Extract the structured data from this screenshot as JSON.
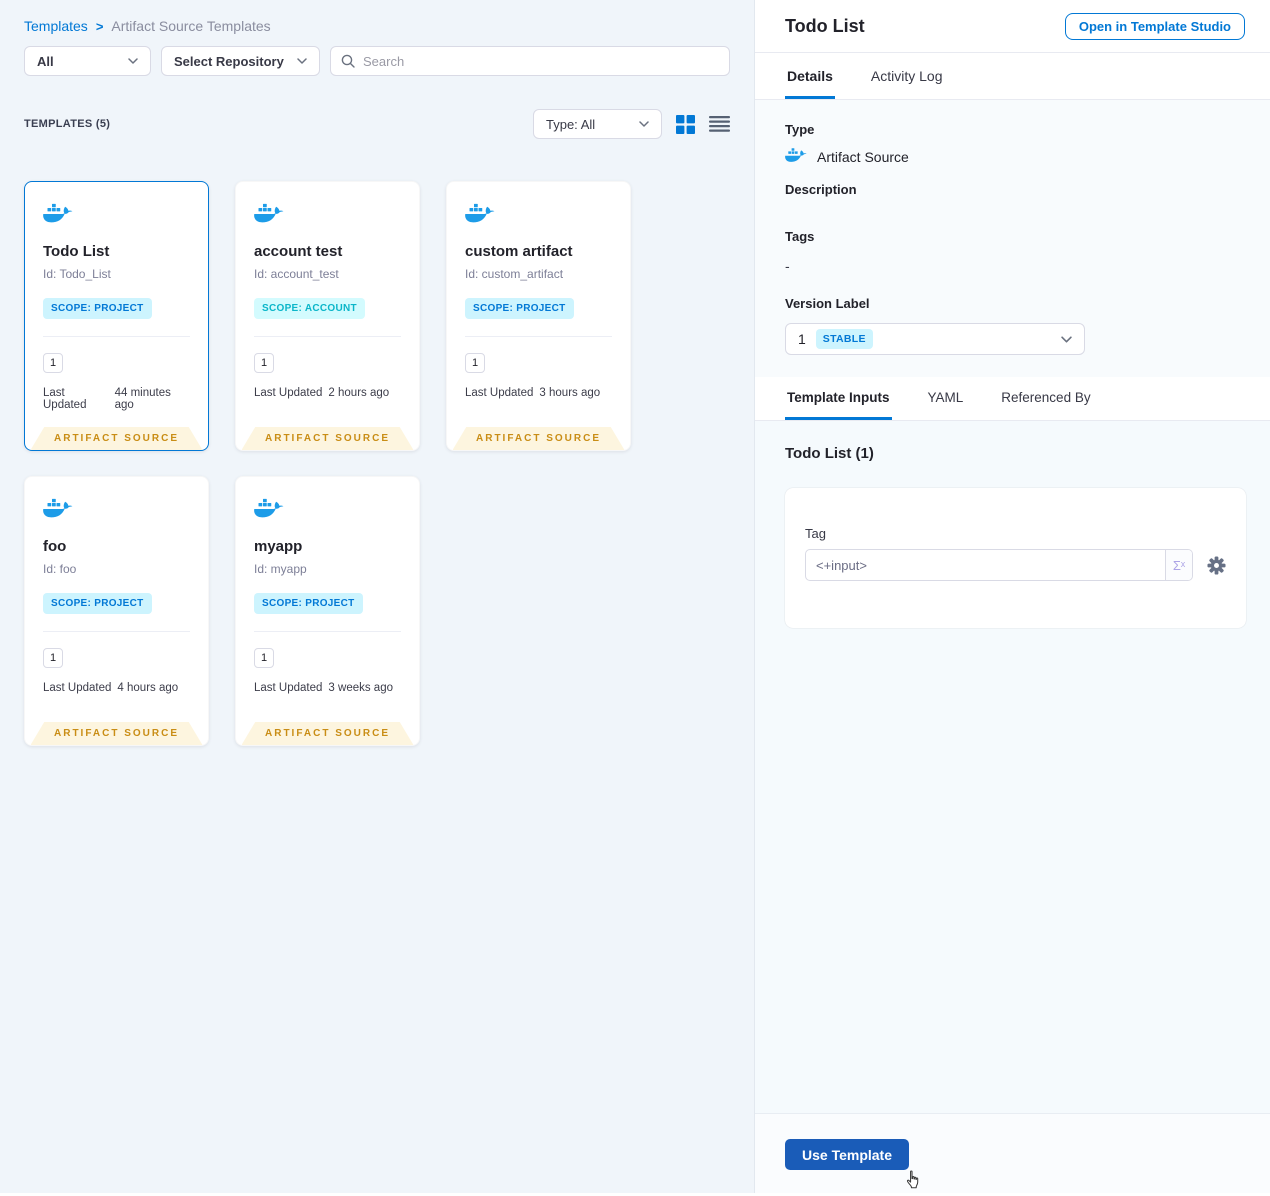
{
  "colors": {
    "accent": "#0278d5",
    "docker-blue": "#1d9ce8",
    "banner-text": "#c98d15",
    "banner-bg": "#fdf5df",
    "scope-project-bg": "#cdf4fe",
    "scope-project-text": "#0278d5",
    "scope-account-bg": "#d3fbfe",
    "scope-account-text": "#0bb6c9",
    "stable-bg": "#cdf4fe",
    "stable-text": "#0278d5",
    "primary-button-bg": "#1a5cb8"
  },
  "breadcrumb": {
    "root": "Templates",
    "separator": ">",
    "current": "Artifact Source Templates"
  },
  "filters": {
    "scope": "All",
    "repository": "Select Repository",
    "search_placeholder": "Search"
  },
  "list_header": {
    "count": "TEMPLATES (5)",
    "type_filter": "Type: All"
  },
  "card_labels": {
    "last_updated": "Last Updated",
    "banner": "ARTIFACT SOURCE"
  },
  "cards": [
    {
      "title": "Todo List",
      "id": "Id: Todo_List",
      "scope": "SCOPE: PROJECT",
      "scope_type": "project",
      "versions": "1",
      "updated": "44 minutes ago"
    },
    {
      "title": "account test",
      "id": "Id: account_test",
      "scope": "SCOPE: ACCOUNT",
      "scope_type": "account",
      "versions": "1",
      "updated": "2 hours ago"
    },
    {
      "title": "custom artifact",
      "id": "Id: custom_artifact",
      "scope": "SCOPE: PROJECT",
      "scope_type": "project",
      "versions": "1",
      "updated": "3 hours ago"
    },
    {
      "title": "foo",
      "id": "Id: foo",
      "scope": "SCOPE: PROJECT",
      "scope_type": "project",
      "versions": "1",
      "updated": "4 hours ago"
    },
    {
      "title": "myapp",
      "id": "Id: myapp",
      "scope": "SCOPE: PROJECT",
      "scope_type": "project",
      "versions": "1",
      "updated": "3 weeks ago"
    }
  ],
  "panel": {
    "title": "Todo List",
    "studio_button": "Open in Template Studio",
    "tabs": {
      "details": "Details",
      "activity": "Activity Log"
    },
    "fields": {
      "type_label": "Type",
      "type_value": "Artifact Source",
      "description_label": "Description",
      "tags_label": "Tags",
      "tags_value": "-",
      "version_label": "Version Label",
      "version_number": "1",
      "version_badge": "STABLE"
    },
    "inputs_tabs": {
      "inputs": "Template Inputs",
      "yaml": "YAML",
      "referenced": "Referenced By"
    },
    "inputs_heading": "Todo List (1)",
    "tag": {
      "label": "Tag",
      "value": "<+input>",
      "expression_symbol": "Σˣ"
    },
    "use_template": "Use Template"
  }
}
